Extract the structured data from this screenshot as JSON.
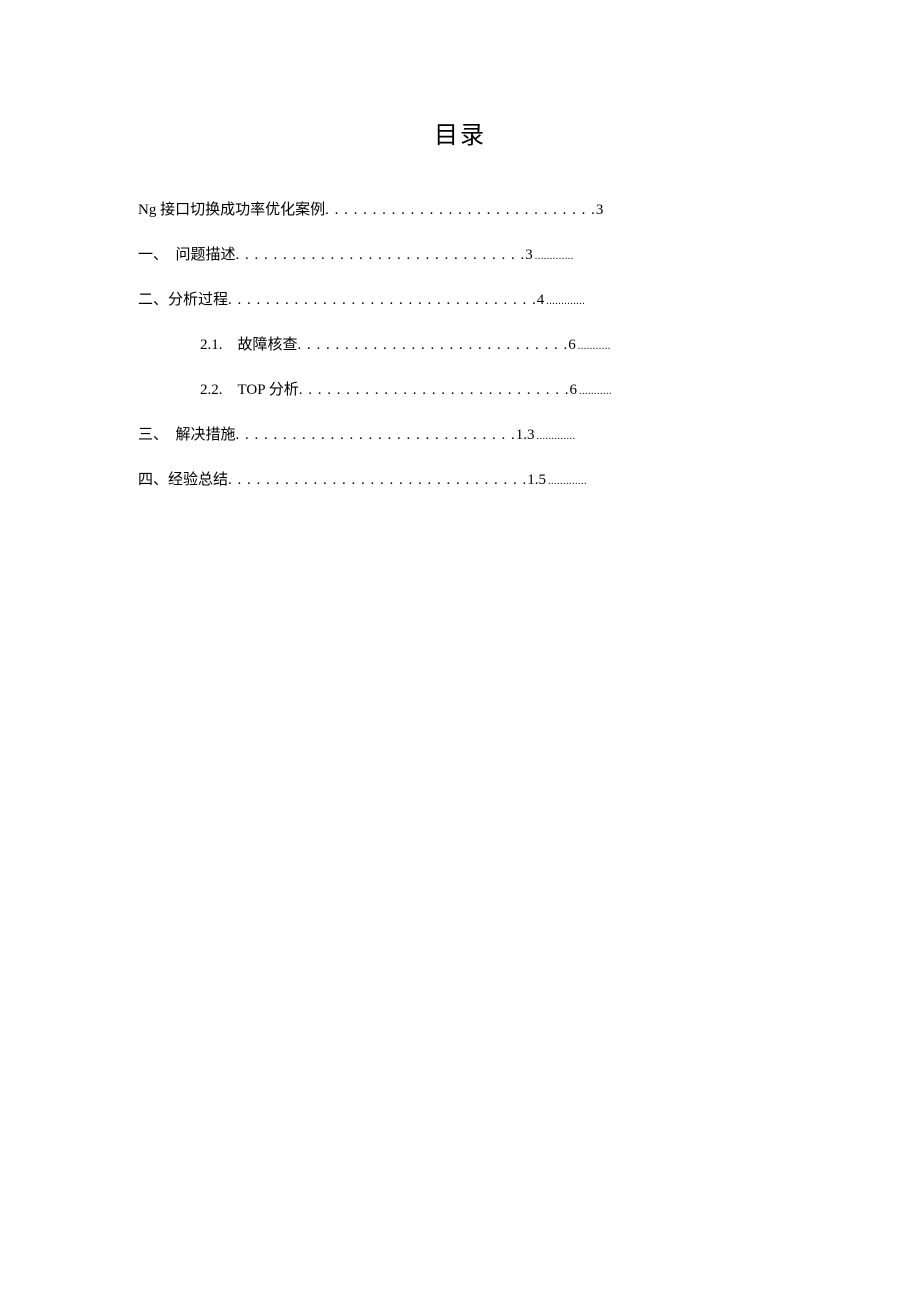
{
  "title": "目录",
  "entries": [
    {
      "label": "Ng 接口切换成功率优化案例",
      "dots": ". . . . . . . . . . . . . . . . . . . . . . . . . . . . .",
      "page": "3",
      "tail": "",
      "indent": false
    },
    {
      "label": "一、　问题描述 ",
      "dots": ". . . . . . . . . . . . . . . . . . . . . . . . . . . . . . .",
      "page": "3",
      "tail": ".............",
      "indent": false
    },
    {
      "label": "二、分析过程",
      "dots": ". . . . . . . . . . . . . . . . . . . . . . . . . . . . . . . . .",
      "page": "4",
      "tail": ".............",
      "indent": false
    },
    {
      "label": "2.1.　故障核查 ",
      "dots": ". . . . . . . . . . . . . . . . . . . . . . . . . . . . .",
      "page": "6",
      "tail": "...........",
      "indent": true
    },
    {
      "label": "2.2.　TOP 分析 ",
      "dots": ". . . . . . . . . . . . . . . . . . . . . . . . . . . . .",
      "page": "6",
      "tail": "...........",
      "indent": true
    },
    {
      "label": "三、　解决措施 ",
      "dots": ". . . . . . . . . . . . . . . . . . . . . . . . . . . . . .",
      "page": "1.3",
      "tail": ".............",
      "indent": false
    },
    {
      "label": "四、经验总结 ",
      "dots": ". . . . . . . . . . . . . . . . . . . . . . . . . . . . . . . .",
      "page": "1.5",
      "tail": ".............",
      "indent": false
    }
  ]
}
